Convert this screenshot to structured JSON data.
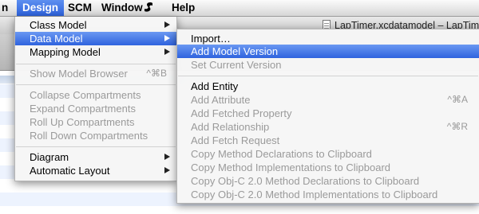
{
  "menubar": {
    "partial": "n",
    "items": [
      "Design",
      "SCM",
      "Window",
      "Help"
    ],
    "script_icon": "script-menu-icon"
  },
  "window": {
    "title": "LapTimer.xcdatamodel – LapTim"
  },
  "design_menu": {
    "items": [
      {
        "label": "Class Model",
        "submenu": true,
        "enabled": true
      },
      {
        "label": "Data Model",
        "submenu": true,
        "enabled": true,
        "highlighted": true
      },
      {
        "label": "Mapping Model",
        "submenu": true,
        "enabled": true
      },
      {
        "label": "Show Model Browser",
        "shortcut": "^⌘B",
        "enabled": false
      },
      {
        "label": "Collapse Compartments",
        "enabled": false
      },
      {
        "label": "Expand Compartments",
        "enabled": false
      },
      {
        "label": "Roll Up Compartments",
        "enabled": false
      },
      {
        "label": "Roll Down Compartments",
        "enabled": false
      },
      {
        "label": "Diagram",
        "submenu": true,
        "enabled": true
      },
      {
        "label": "Automatic Layout",
        "submenu": true,
        "enabled": true
      }
    ]
  },
  "data_model_submenu": {
    "items": [
      {
        "label": "Import…",
        "enabled": true
      },
      {
        "label": "Add Model Version",
        "enabled": true,
        "highlighted": true
      },
      {
        "label": "Set Current Version",
        "enabled": false
      },
      {
        "label": "Add Entity",
        "enabled": true
      },
      {
        "label": "Add Attribute",
        "shortcut": "^⌘A",
        "enabled": false
      },
      {
        "label": "Add Fetched Property",
        "enabled": false
      },
      {
        "label": "Add Relationship",
        "shortcut": "^⌘R",
        "enabled": false
      },
      {
        "label": "Add Fetch Request",
        "enabled": false
      },
      {
        "label": "Copy Method Declarations to Clipboard",
        "enabled": false
      },
      {
        "label": "Copy Method Implementations to Clipboard",
        "enabled": false
      },
      {
        "label": "Copy Obj-C 2.0 Method Declarations to Clipboard",
        "enabled": false
      },
      {
        "label": "Copy Obj-C 2.0 Method Implementations to Clipboard",
        "enabled": false
      }
    ]
  },
  "colors": {
    "highlight": "#3b6fe0",
    "disabled_text": "#9a9a9a"
  }
}
